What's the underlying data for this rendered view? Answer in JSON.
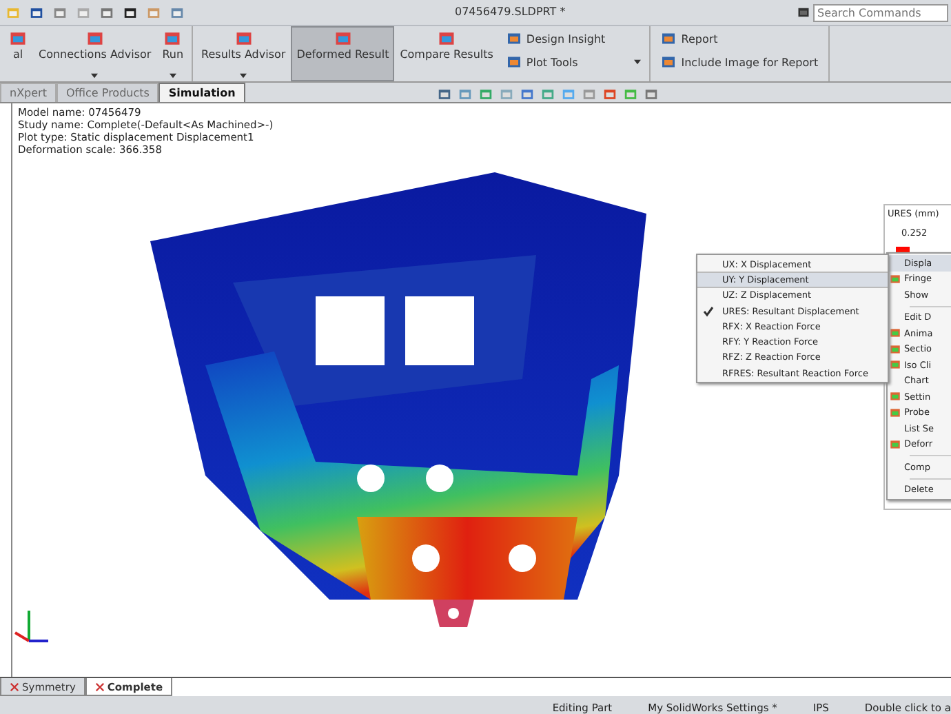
{
  "window": {
    "title": "07456479.SLDPRT *",
    "search": {
      "placeholder": "Search Commands"
    }
  },
  "ribbon": {
    "groups": [
      {
        "items": [
          {
            "label": "al",
            "kind": "large",
            "selected": false,
            "dropdown": false
          },
          {
            "label": "Connections Advisor",
            "kind": "large",
            "selected": false,
            "dropdown": true
          },
          {
            "label": "Run",
            "kind": "large",
            "selected": false,
            "dropdown": true
          }
        ]
      },
      {
        "items": [
          {
            "label": "Results Advisor",
            "kind": "large",
            "selected": false,
            "dropdown": true
          },
          {
            "label": "Deformed Result",
            "kind": "large",
            "selected": true,
            "dropdown": false
          },
          {
            "label": "Compare Results",
            "kind": "large",
            "selected": false,
            "dropdown": false
          },
          {
            "label": "Design Insight",
            "kind": "small",
            "selected": false,
            "dropdown": false
          },
          {
            "label": "Plot Tools",
            "kind": "small",
            "selected": false,
            "dropdown": true
          }
        ]
      },
      {
        "items": [
          {
            "label": "Report",
            "kind": "small",
            "selected": false,
            "dropdown": false
          },
          {
            "label": "Include Image for Report",
            "kind": "small",
            "selected": false,
            "dropdown": false
          }
        ]
      }
    ]
  },
  "tabs": [
    {
      "label": "nXpert",
      "selected": false
    },
    {
      "label": "Office Products",
      "selected": false
    },
    {
      "label": "Simulation",
      "selected": true
    }
  ],
  "plot_info": [
    "Model name: 07456479",
    "Study name: Complete(-Default<As Machined>-)",
    "Plot type: Static displacement Displacement1",
    "Deformation scale: 366.358"
  ],
  "legend": {
    "title": "URES (mm)",
    "max": "0.252"
  },
  "submenu": [
    {
      "label": "UX: X Displacement",
      "selected": false,
      "checked": false
    },
    {
      "label": "UY: Y Displacement",
      "selected": true,
      "checked": false
    },
    {
      "label": "UZ: Z Displacement",
      "selected": false,
      "checked": false
    },
    {
      "label": "URES: Resultant Displacement",
      "selected": false,
      "checked": true
    },
    {
      "label": "RFX: X Reaction Force",
      "selected": false,
      "checked": false
    },
    {
      "label": "RFY: Y Reaction Force",
      "selected": false,
      "checked": false
    },
    {
      "label": "RFZ: Z Reaction Force",
      "selected": false,
      "checked": false
    },
    {
      "label": "RFRES: Resultant Reaction Force",
      "selected": false,
      "checked": false
    }
  ],
  "context_menu": [
    [
      {
        "label": "Displa",
        "selected": true,
        "icon": false
      },
      {
        "label": "Fringe",
        "selected": false,
        "icon": true
      },
      {
        "label": "Show",
        "selected": false,
        "icon": false
      }
    ],
    [
      {
        "label": "Edit D",
        "selected": false,
        "icon": false
      },
      {
        "label": "Anima",
        "selected": false,
        "icon": true
      },
      {
        "label": "Sectio",
        "selected": false,
        "icon": true
      },
      {
        "label": "Iso Cli",
        "selected": false,
        "icon": true
      },
      {
        "label": "Chart",
        "selected": false,
        "icon": false
      },
      {
        "label": "Settin",
        "selected": false,
        "icon": true
      },
      {
        "label": "Probe",
        "selected": false,
        "icon": true
      },
      {
        "label": "List Se",
        "selected": false,
        "icon": false
      },
      {
        "label": "Deforr",
        "selected": false,
        "icon": true
      }
    ],
    [
      {
        "label": "Comp",
        "selected": false,
        "icon": false
      }
    ],
    [
      {
        "label": "Delete",
        "selected": false,
        "icon": false
      }
    ]
  ],
  "study_tabs": [
    {
      "label": "Symmetry",
      "selected": false
    },
    {
      "label": "Complete",
      "selected": true
    }
  ],
  "status_bar": {
    "fields": [
      "Editing Part",
      "My SolidWorks Settings *",
      "IPS",
      "Double click to a"
    ]
  }
}
